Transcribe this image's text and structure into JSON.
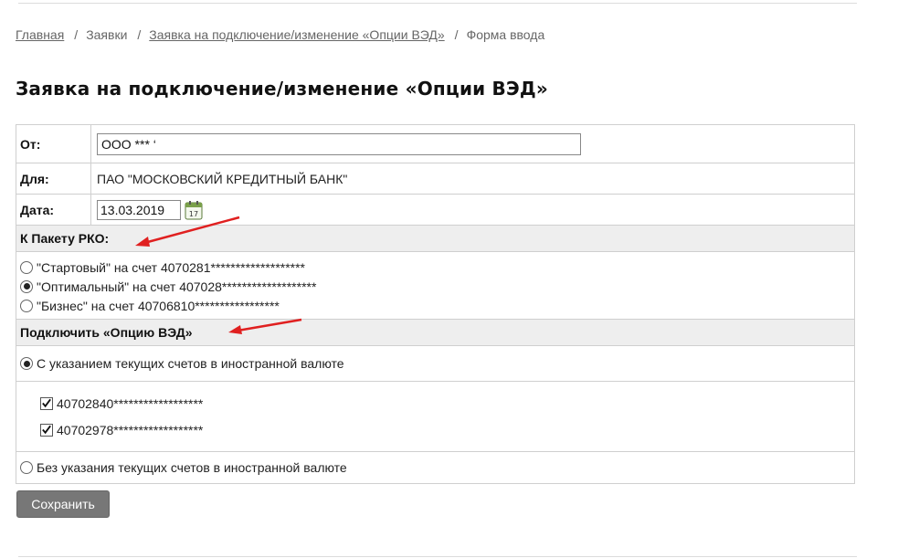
{
  "breadcrumb": {
    "home": "Главная",
    "requests": "Заявки",
    "connect_ved": "Заявка на подключение/изменение «Опции ВЭД»",
    "current": "Форма ввода",
    "separator": "/"
  },
  "page_title": "Заявка на подключение/изменение «Опции ВЭД»",
  "form": {
    "from_label": "От:",
    "from_value": "ООО *** ‘",
    "for_label": "Для:",
    "for_value": "ПАО \"МОСКОВСКИЙ КРЕДИТНЫЙ БАНК\"",
    "date_label": "Дата:",
    "date_value": "13.03.2019",
    "rko_header": "К Пакету РКО:",
    "rko_options": [
      {
        "label": "\"Стартовый\" на счет 4070281*******************",
        "selected": false
      },
      {
        "label": "\"Оптимальный\" на счет 407028*******************",
        "selected": true
      },
      {
        "label": "\"Бизнес\" на счет 40706810*****************",
        "selected": false
      }
    ],
    "ved_header": "Подключить «Опцию ВЭД»",
    "ved_with_accounts": "С указанием текущих счетов в иностранной валюте",
    "ved_with_selected": true,
    "accounts": [
      {
        "number": "40702840******************",
        "checked": true
      },
      {
        "number": "40702978******************",
        "checked": true
      }
    ],
    "ved_without_accounts": "Без указания текущих счетов в иностранной валюте"
  },
  "buttons": {
    "save": "Сохранить"
  },
  "colors": {
    "annotation_arrow": "#e02020",
    "button_bg": "#777777",
    "section_bg": "#eeeeee"
  },
  "icons": {
    "calendar": "calendar-icon"
  }
}
